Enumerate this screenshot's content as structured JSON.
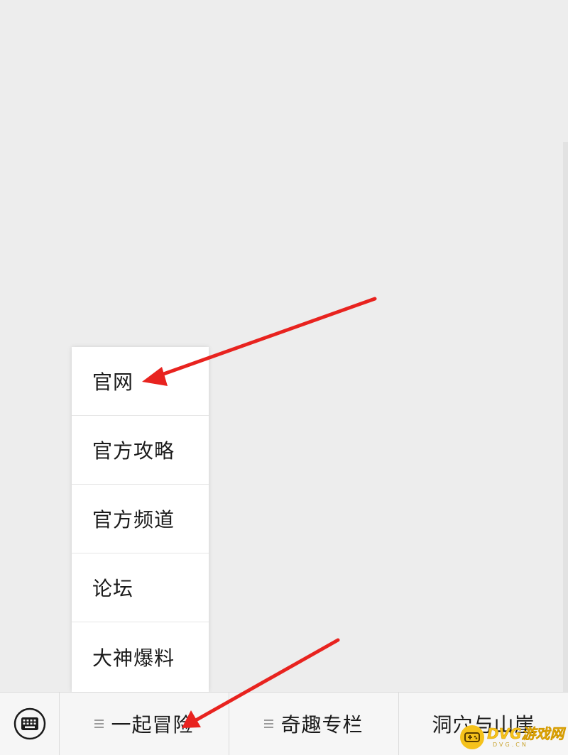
{
  "popup_menu": {
    "items": [
      "官网",
      "官方攻略",
      "官方频道",
      "论坛",
      "大神爆料"
    ]
  },
  "bottom_bar": {
    "keyboard_icon": "keyboard-icon",
    "tabs": [
      {
        "label": "一起冒险",
        "has_submenu": true
      },
      {
        "label": "奇趣专栏",
        "has_submenu": true
      },
      {
        "label": "洞穴与山崖",
        "has_submenu": false
      }
    ]
  },
  "annotations": {
    "arrow_color": "#e8231f"
  },
  "watermark": {
    "brand": "DVG游戏网",
    "domain": "DVG.CN",
    "logo_icon": "gamepad-icon",
    "color": "#f5c21b"
  },
  "colors": {
    "background": "#ededed",
    "menu_background": "#ffffff",
    "bar_background": "#f6f6f6",
    "text": "#1a1a1a"
  }
}
